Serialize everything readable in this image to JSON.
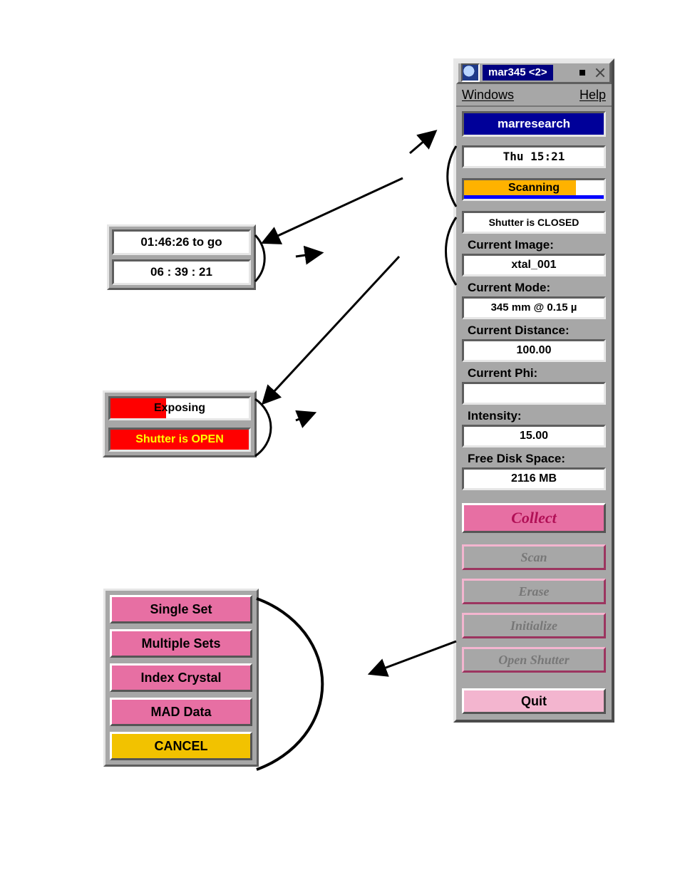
{
  "title": "mar345 <2>",
  "menu": {
    "windows": "Windows",
    "help": "Help"
  },
  "brand": "marresearch",
  "datetime": "Thu   15:21",
  "scan": {
    "label": "Scanning",
    "percent": 80
  },
  "shutter_closed": "Shutter is CLOSED",
  "fields": {
    "image": {
      "label": "Current Image:",
      "value": "xtal_001"
    },
    "mode": {
      "label": "Current Mode:",
      "value": "345 mm @ 0.15 µ"
    },
    "distance": {
      "label": "Current Distance:",
      "value": "100.00"
    },
    "phi": {
      "label": "Current Phi:",
      "value": ""
    },
    "intensity": {
      "label": "Intensity:",
      "value": "15.00"
    },
    "disk": {
      "label": "Free Disk Space:",
      "value": "2116 MB"
    }
  },
  "actions": {
    "collect": "Collect",
    "scan": "Scan",
    "erase": "Erase",
    "init": "Initialize",
    "open_shutter": "Open Shutter",
    "quit": "Quit"
  },
  "popup_time": {
    "remaining": "01:46:26 to go",
    "elapsed": "06 : 39 : 21"
  },
  "popup_expose": {
    "label": "Exposing",
    "percent": 40,
    "shutter": "Shutter is OPEN"
  },
  "popup_collect": {
    "single": "Single Set",
    "multiple": "Multiple Sets",
    "index": "Index Crystal",
    "mad": "MAD Data",
    "cancel": "CANCEL"
  }
}
